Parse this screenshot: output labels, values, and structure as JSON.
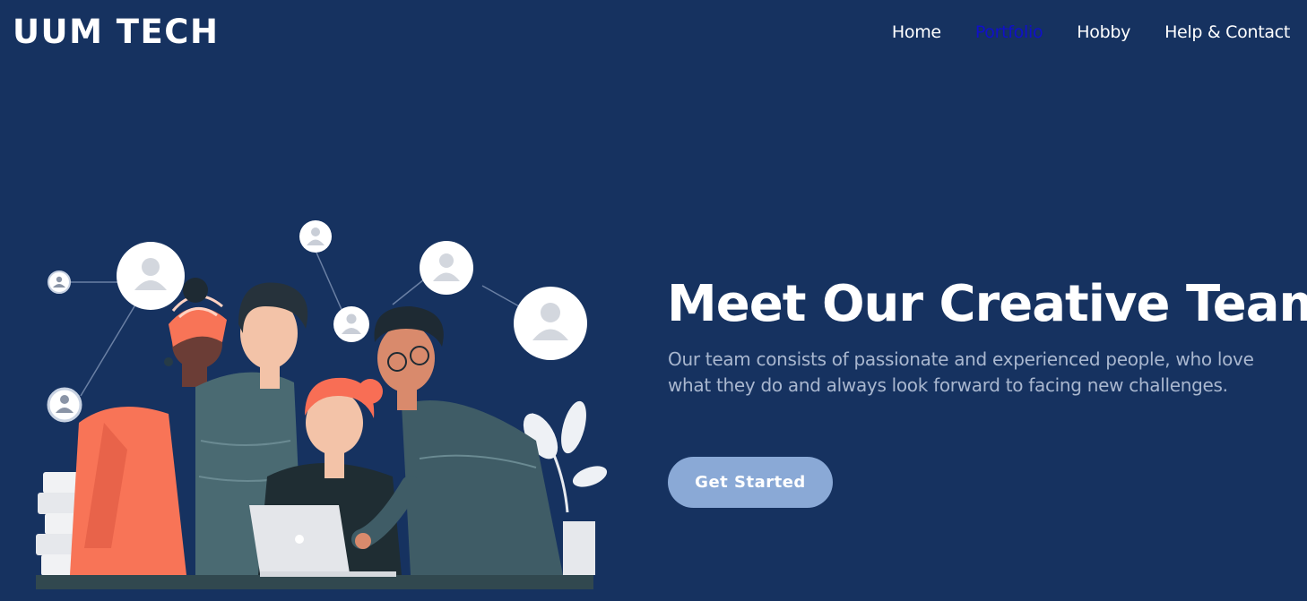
{
  "header": {
    "brand": "UUM TECH",
    "nav": [
      {
        "label": "Home",
        "active": false
      },
      {
        "label": "Portfolio",
        "active": true
      },
      {
        "label": "Hobby",
        "active": false
      },
      {
        "label": "Help & Contact",
        "active": false
      }
    ]
  },
  "hero": {
    "title": "Meet Our Creative Team",
    "description": "Our team consists of passionate and experienced people, who love what they do and always look forward to facing new challenges.",
    "cta_label": "Get Started"
  },
  "colors": {
    "background": "#163260",
    "nav_active": "#1010c8",
    "cta": "#8aa9d6",
    "description": "#a9b7cf"
  }
}
